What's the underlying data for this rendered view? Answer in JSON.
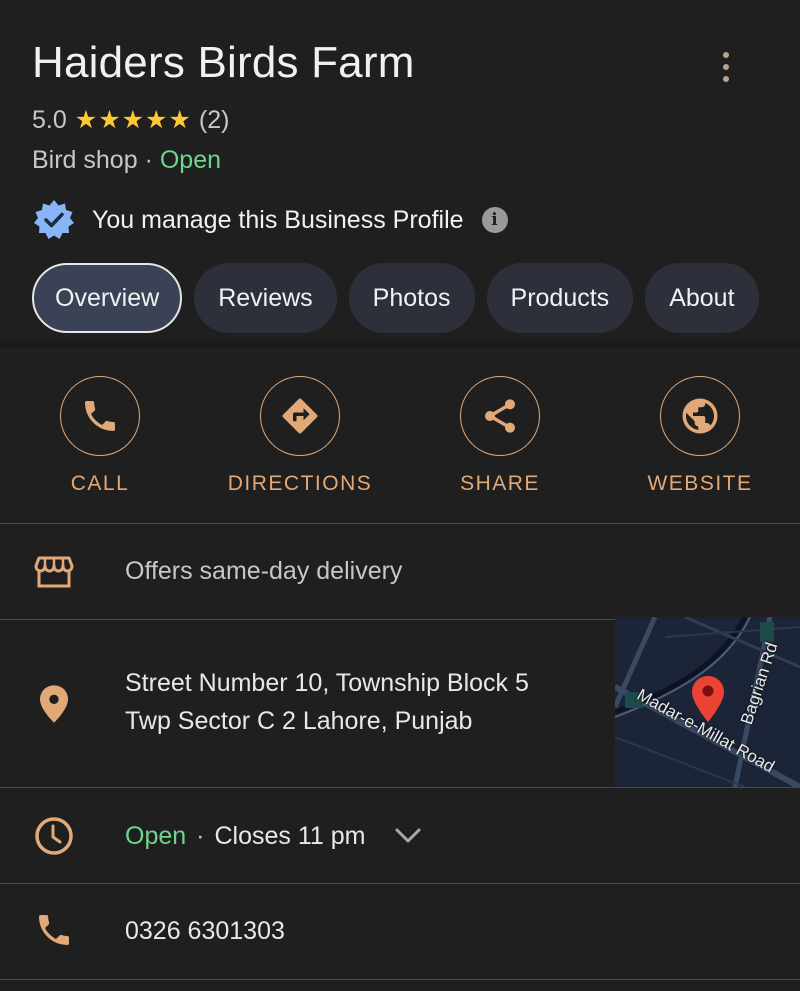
{
  "header": {
    "title": "Haiders Birds Farm",
    "more_icon": "more-vert-icon",
    "rating": "5.0",
    "stars": 5,
    "review_count": "(2)",
    "category": "Bird shop",
    "separator": " · ",
    "status": "Open",
    "manage_text": "You manage this Business Profile",
    "verified_icon": "verified-badge-icon",
    "info_icon": "info-icon"
  },
  "tabs": [
    {
      "label": "Overview",
      "active": true
    },
    {
      "label": "Reviews",
      "active": false
    },
    {
      "label": "Photos",
      "active": false
    },
    {
      "label": "Products",
      "active": false
    },
    {
      "label": "About",
      "active": false
    }
  ],
  "actions": [
    {
      "label": "CALL",
      "icon": "phone-icon"
    },
    {
      "label": "DIRECTIONS",
      "icon": "directions-icon"
    },
    {
      "label": "SHARE",
      "icon": "share-icon"
    },
    {
      "label": "WEBSITE",
      "icon": "globe-icon"
    }
  ],
  "details": {
    "delivery": {
      "text": "Offers same-day delivery",
      "icon": "storefront-icon"
    },
    "address": {
      "line1": "Street Number 10, Township Block 5",
      "line2": "Twp Sector C 2 Lahore, Punjab",
      "icon": "location-pin-icon"
    },
    "map": {
      "road1": "Madar-e-Millat Road",
      "road2": "Bagrian Rd"
    },
    "hours": {
      "status": "Open",
      "separator": "·",
      "closes": "Closes 11 pm",
      "icon": "clock-icon"
    },
    "phone": {
      "number": "0326 6301303",
      "icon": "phone-icon"
    }
  },
  "colors": {
    "background": "#1f1f1f",
    "accent": "#e2a978",
    "open_green": "#6dd58c",
    "star": "#fcc934",
    "verified_blue": "#8ab4f8",
    "map_pin": "#ea4335"
  }
}
